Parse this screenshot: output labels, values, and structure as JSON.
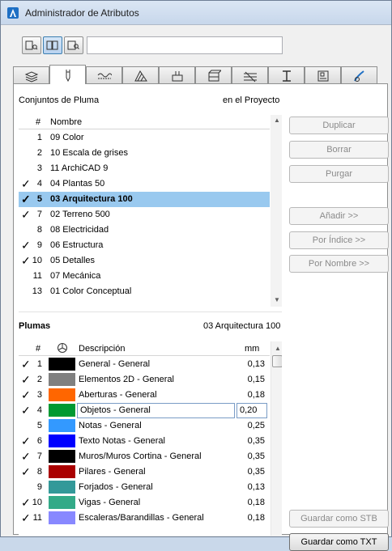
{
  "window": {
    "title": "Administrador de Atributos"
  },
  "toolbar": {
    "search_value": "",
    "mode_icons": [
      "list-view-icon",
      "two-panel-icon",
      "search-panel-icon"
    ],
    "active_mode": 1
  },
  "tabs": [
    {
      "icon": "layers-icon"
    },
    {
      "icon": "pen-icon",
      "active": true
    },
    {
      "icon": "line-type-icon"
    },
    {
      "icon": "fill-icon"
    },
    {
      "icon": "composite-icon"
    },
    {
      "icon": "profile-icon"
    },
    {
      "icon": "surface-icon"
    },
    {
      "icon": "zone-icon"
    },
    {
      "icon": "markup-icon"
    },
    {
      "icon": "brush-icon"
    }
  ],
  "pen_sets": {
    "section_label": "Conjuntos de Pluma",
    "context_label": "en el Proyecto",
    "columns": {
      "num": "#",
      "name": "Nombre"
    },
    "rows": [
      {
        "num": "1",
        "name": "09 Color",
        "checked": false
      },
      {
        "num": "2",
        "name": "10 Escala de grises",
        "checked": false
      },
      {
        "num": "3",
        "name": "11 ArchiCAD 9",
        "checked": false
      },
      {
        "num": "4",
        "name": "04 Plantas 50",
        "checked": true
      },
      {
        "num": "5",
        "name": "03 Arquitectura 100",
        "checked": true,
        "selected": true
      },
      {
        "num": "7",
        "name": "02 Terreno 500",
        "checked": true
      },
      {
        "num": "8",
        "name": "08 Electricidad",
        "checked": false
      },
      {
        "num": "9",
        "name": "06 Estructura",
        "checked": true
      },
      {
        "num": "10",
        "name": "05 Detalles",
        "checked": true
      },
      {
        "num": "11",
        "name": "07 Mecánica",
        "checked": false
      },
      {
        "num": "13",
        "name": "01 Color Conceptual",
        "checked": false
      }
    ]
  },
  "buttons": {
    "duplicar": "Duplicar",
    "borrar": "Borrar",
    "purgar": "Purgar",
    "anadir": "Añadir >>",
    "por_indice": "Por Índice >>",
    "por_nombre": "Por Nombre >>",
    "guardar_stb": "Guardar como STB",
    "guardar_txt": "Guardar como TXT"
  },
  "pens": {
    "section_label": "Plumas",
    "context_label": "03 Arquitectura 100",
    "columns": {
      "num": "#",
      "desc": "Descripción",
      "mm": "mm"
    },
    "rows": [
      {
        "num": "1",
        "color": "#000000",
        "desc": "General - General",
        "mm": "0,13",
        "checked": true
      },
      {
        "num": "2",
        "color": "#808080",
        "desc": "Elementos 2D - General",
        "mm": "0,15",
        "checked": true
      },
      {
        "num": "3",
        "color": "#ff6600",
        "desc": "Aberturas - General",
        "mm": "0,18",
        "checked": true
      },
      {
        "num": "4",
        "color": "#009933",
        "desc": "Objetos - General",
        "mm": "0,20",
        "checked": true,
        "editing": true
      },
      {
        "num": "5",
        "color": "#3399ff",
        "desc": "Notas - General",
        "mm": "0,25",
        "checked": false
      },
      {
        "num": "6",
        "color": "#0000ff",
        "desc": "Texto Notas - General",
        "mm": "0,35",
        "checked": true
      },
      {
        "num": "7",
        "color": "#000000",
        "desc": "Muros/Muros Cortina - General",
        "mm": "0,35",
        "checked": true
      },
      {
        "num": "8",
        "color": "#aa0000",
        "desc": "Pilares - General",
        "mm": "0,35",
        "checked": true
      },
      {
        "num": "9",
        "color": "#339999",
        "desc": "Forjados - General",
        "mm": "0,13",
        "checked": false
      },
      {
        "num": "10",
        "color": "#33aa88",
        "desc": "Vigas - General",
        "mm": "0,18",
        "checked": true
      },
      {
        "num": "11",
        "color": "#8888ff",
        "desc": "Escaleras/Barandillas - General",
        "mm": "0,18",
        "checked": true
      }
    ]
  }
}
